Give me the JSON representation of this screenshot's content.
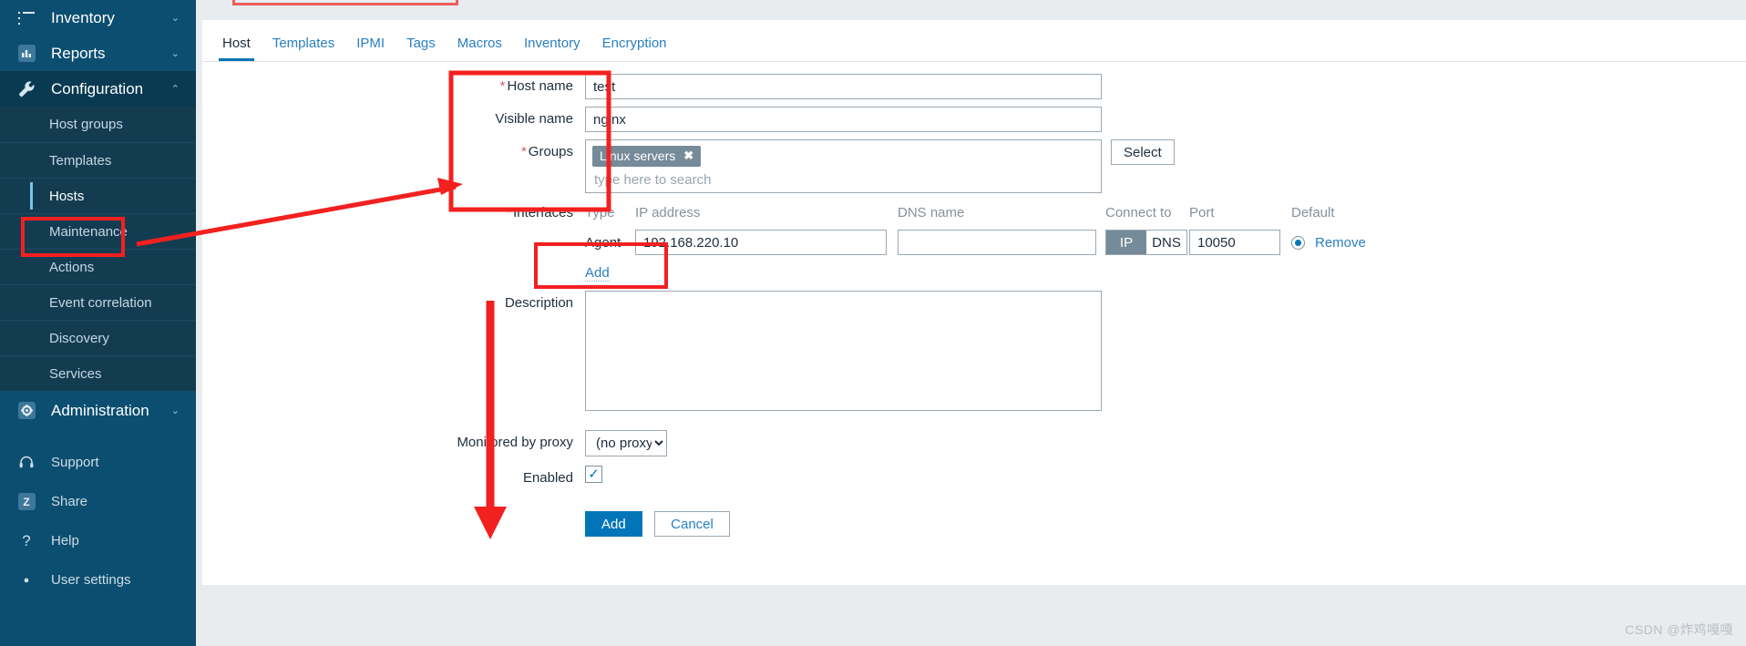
{
  "sidebar": {
    "items": [
      {
        "label": "Inventory",
        "icon": "list-icon",
        "chevron": "⌄",
        "type": "top"
      },
      {
        "label": "Reports",
        "icon": "chart-icon",
        "chevron": "⌄",
        "type": "top"
      },
      {
        "label": "Configuration",
        "icon": "wrench-icon",
        "chevron": "⌃",
        "type": "top",
        "expanded": true
      }
    ],
    "config_submenu": [
      {
        "label": "Host groups"
      },
      {
        "label": "Templates"
      },
      {
        "label": "Hosts",
        "active": true,
        "highlighted": true
      },
      {
        "label": "Maintenance"
      },
      {
        "label": "Actions"
      },
      {
        "label": "Event correlation"
      },
      {
        "label": "Discovery"
      },
      {
        "label": "Services"
      }
    ],
    "administration": {
      "label": "Administration",
      "icon": "gear-icon",
      "chevron": "⌄"
    },
    "bottom_items": [
      {
        "label": "Support",
        "icon": "headset-icon"
      },
      {
        "label": "Share",
        "icon": "zabbix-share-icon",
        "glyph": "Z"
      },
      {
        "label": "Help",
        "icon": "question-icon",
        "glyph": "?"
      },
      {
        "label": "User settings",
        "icon": "user-icon",
        "glyph": "●"
      }
    ]
  },
  "tabs": [
    {
      "label": "Host",
      "active": true
    },
    {
      "label": "Templates",
      "active": false
    },
    {
      "label": "IPMI",
      "active": false
    },
    {
      "label": "Tags",
      "active": false
    },
    {
      "label": "Macros",
      "active": false
    },
    {
      "label": "Inventory",
      "active": false
    },
    {
      "label": "Encryption",
      "active": false
    }
  ],
  "form": {
    "host_name": {
      "label": "Host name",
      "required": true,
      "value": "test"
    },
    "visible_name": {
      "label": "Visible name",
      "required": false,
      "value": "nginx"
    },
    "groups": {
      "label": "Groups",
      "required": true,
      "chips": [
        {
          "label": "Linux servers",
          "remove_glyph": "✖"
        }
      ],
      "placeholder": "type here to search",
      "select_button": "Select"
    },
    "interfaces": {
      "label": "Interfaces",
      "required": true,
      "headers": [
        "Type",
        "IP address",
        "DNS name",
        "Connect to",
        "Port",
        "Default"
      ],
      "rows": [
        {
          "type": "Agent",
          "ip": "192.168.220.10",
          "dns": "",
          "connect_to": {
            "options": [
              "IP",
              "DNS"
            ],
            "selected": "IP"
          },
          "port": "10050",
          "default_selected": true,
          "remove_label": "Remove"
        }
      ],
      "add_link": "Add"
    },
    "description": {
      "label": "Description",
      "value": "",
      "placeholder": ""
    },
    "proxy": {
      "label": "Monitored by proxy",
      "value": "(no proxy)",
      "options": [
        "(no proxy)"
      ]
    },
    "enabled": {
      "label": "Enabled",
      "checked": true,
      "check_glyph": "✓"
    },
    "submit": {
      "label": "Add"
    },
    "cancel": {
      "label": "Cancel"
    }
  },
  "watermark": "CSDN @炸鸡嘎嘎",
  "colors": {
    "sidebar_bg": "#0c4e70",
    "submenu_bg": "#143c51",
    "accent_blue": "#0275b8",
    "link_blue": "#2a7fc1",
    "annotation_red": "#f32020",
    "chip_grey": "#768b99"
  }
}
